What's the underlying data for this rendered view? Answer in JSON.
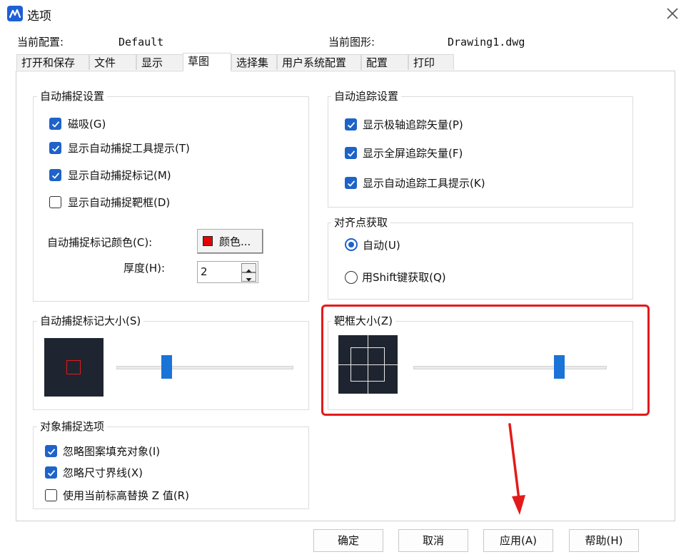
{
  "window": {
    "title": "选项"
  },
  "header": {
    "current_profile_label": "当前配置:",
    "current_profile_value": "Default",
    "current_drawing_label": "当前图形:",
    "current_drawing_value": "Drawing1.dwg"
  },
  "tabs": [
    {
      "label": "打开和保存"
    },
    {
      "label": "文件"
    },
    {
      "label": "显示"
    },
    {
      "label": "草图",
      "active": true
    },
    {
      "label": "选择集"
    },
    {
      "label": "用户系统配置"
    },
    {
      "label": "配置"
    },
    {
      "label": "打印"
    }
  ],
  "autosnap": {
    "title": "自动捕捉设置",
    "magnet": {
      "label": "磁吸(G)",
      "checked": true
    },
    "show_tooltip": {
      "label": "显示自动捕捉工具提示(T)",
      "checked": true
    },
    "show_marker": {
      "label": "显示自动捕捉标记(M)",
      "checked": true
    },
    "show_aperture": {
      "label": "显示自动捕捉靶框(D)",
      "checked": false
    },
    "marker_color_label": "自动捕捉标记颜色(C):",
    "color_button_label": "颜色...",
    "marker_color": "#e60000",
    "thickness_label": "厚度(H):",
    "thickness_value": "2"
  },
  "autotrack": {
    "title": "自动追踪设置",
    "polar": {
      "label": "显示极轴追踪矢量(P)",
      "checked": true
    },
    "fullscreen": {
      "label": "显示全屏追踪矢量(F)",
      "checked": true
    },
    "tooltip": {
      "label": "显示自动追踪工具提示(K)",
      "checked": true
    }
  },
  "alignment": {
    "title": "对齐点获取",
    "auto": {
      "label": "自动(U)",
      "selected": true
    },
    "shift": {
      "label": "用Shift键获取(Q)",
      "selected": false
    }
  },
  "marker_size": {
    "title": "自动捕捉标记大小(S)",
    "level": 0.27
  },
  "aperture_size": {
    "title": "靶框大小(Z)",
    "level": 0.77
  },
  "object_snap": {
    "title": "对象捕捉选项",
    "ignore_hatch": {
      "label": "忽略图案填充对象(I)",
      "checked": true
    },
    "ignore_dim": {
      "label": "忽略尺寸界线(X)",
      "checked": true
    },
    "replace_z": {
      "label": "使用当前标高替换 Z 值(R)",
      "checked": false
    }
  },
  "buttons": {
    "ok": "确定",
    "cancel": "取消",
    "apply": "应用(A)",
    "help": "帮助(H)"
  },
  "colors": {
    "accent": "#1e63c8",
    "highlight": "#e31a1a",
    "preview_bg": "#1f2530"
  }
}
